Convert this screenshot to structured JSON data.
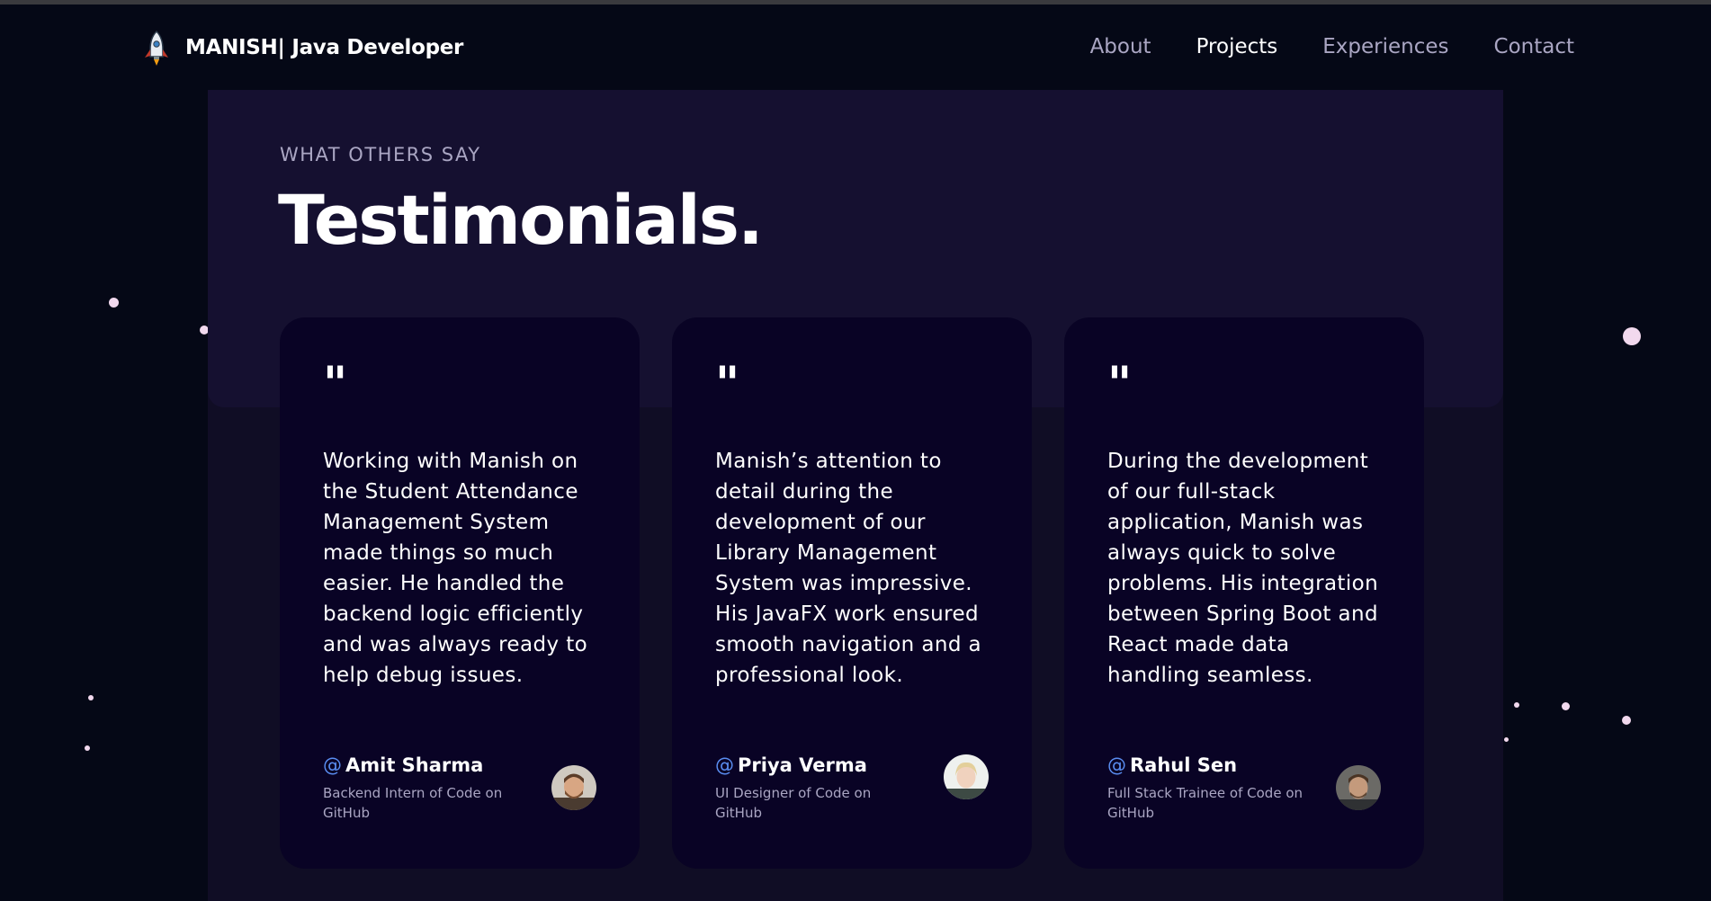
{
  "nav": {
    "brand": "MANISH| Java Developer",
    "links": [
      {
        "label": "About"
      },
      {
        "label": "Projects"
      },
      {
        "label": "Experiences"
      },
      {
        "label": "Contact"
      }
    ]
  },
  "section": {
    "eyebrow": "WHAT OTHERS SAY",
    "title": "Testimonials."
  },
  "testimonials": [
    {
      "quote_mark": "\"",
      "text": "Working with Manish on the Student Attendance Management System made things so much easier. He handled the backend logic efficiently and was always ready to help debug issues.",
      "at": "@",
      "name": "Amit Sharma",
      "role": "Backend Intern of Code on GitHub"
    },
    {
      "quote_mark": "\"",
      "text": "Manish’s attention to detail during the development of our Library Management System was impressive. His JavaFX work ensured smooth navigation and a professional look.",
      "at": "@",
      "name": "Priya Verma",
      "role": "UI Designer of Code on GitHub"
    },
    {
      "quote_mark": "\"",
      "text": "During the development of our full-stack application, Manish was always quick to solve problems. His integration between Spring Boot and React made data handling seamless.",
      "at": "@",
      "name": "Rahul Sen",
      "role": "Full Stack Trainee of Code on GitHub"
    }
  ],
  "colors": {
    "background": "#050816",
    "panel": "#100d25",
    "panel_head": "#151030",
    "card": "#090325",
    "secondary_text": "#aaa6c3",
    "accent": "#5a8ef2"
  },
  "icons": {
    "brand": "rocket-icon"
  }
}
